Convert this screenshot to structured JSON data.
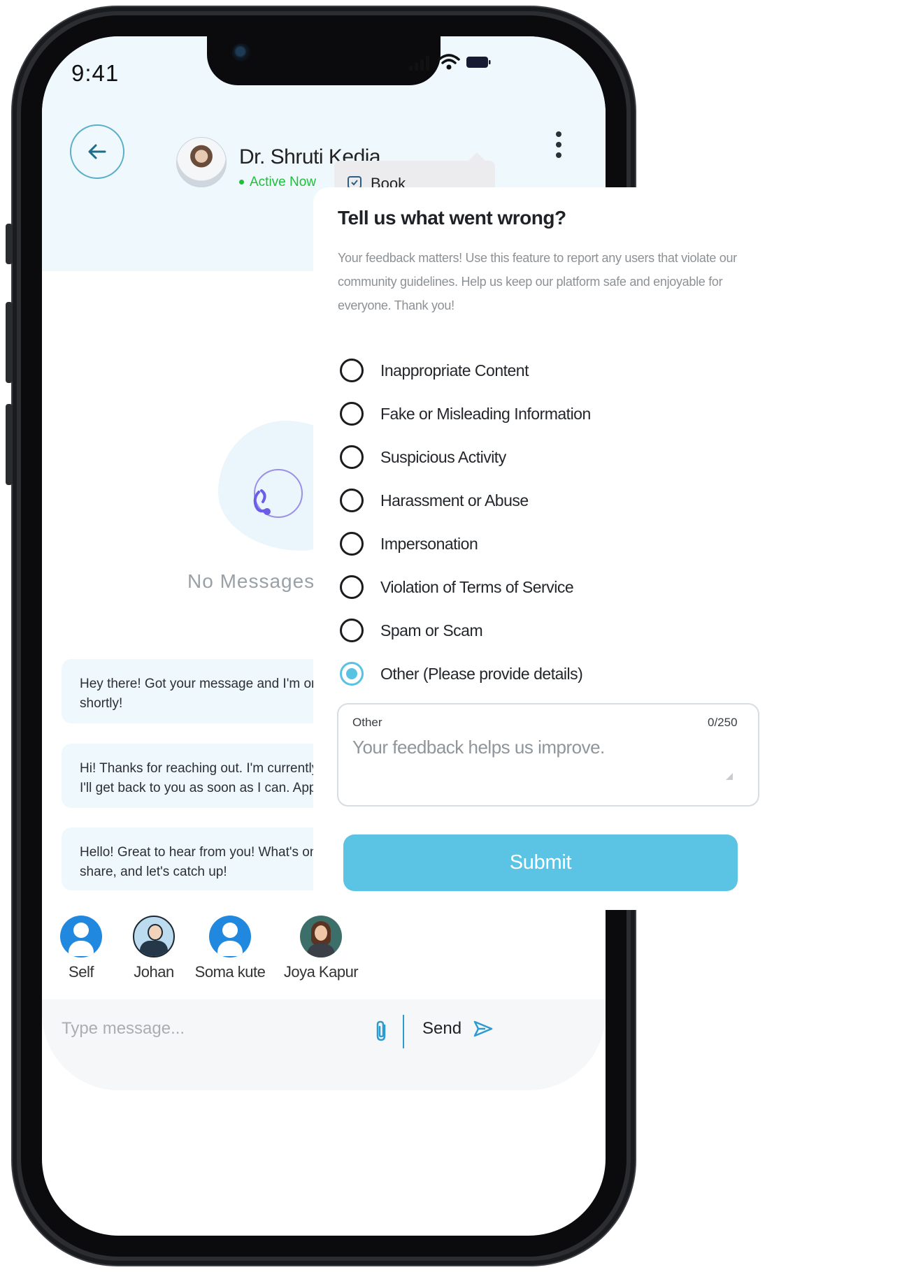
{
  "status_bar": {
    "time": "9:41"
  },
  "chat_header": {
    "doctor_name": "Dr. Shruti Kedia",
    "status": "Active Now",
    "menu_item_label": "Book"
  },
  "empty_state": {
    "text": "No Messages"
  },
  "quick_replies": [
    {
      "line1": "Hey there! Got your message and I'm on i",
      "line2": "shortly!"
    },
    {
      "line1": "Hi! Thanks for reaching out. I'm currently t",
      "line2": "I'll get back to you as soon as I can. Appre"
    },
    {
      "line1": "Hello! Great to hear from you! What's on y",
      "line2": "share, and let's catch up!"
    }
  ],
  "contacts": [
    {
      "name": "Self"
    },
    {
      "name": "Johan"
    },
    {
      "name": "Soma kute"
    },
    {
      "name": "Joya Kapur"
    }
  ],
  "composer": {
    "placeholder": "Type message...",
    "send_label": "Send"
  },
  "feedback": {
    "title": "Tell us what went wrong?",
    "description": "Your feedback matters! Use this feature to report any users that violate our community guidelines. Help us keep our platform safe and enjoyable for everyone. Thank you!",
    "options": [
      {
        "label": "Inappropriate Content",
        "selected": false
      },
      {
        "label": "Fake or Misleading Information",
        "selected": false
      },
      {
        "label": "Suspicious Activity",
        "selected": false
      },
      {
        "label": "Harassment or Abuse",
        "selected": false
      },
      {
        "label": "Impersonation",
        "selected": false
      },
      {
        "label": "Violation of Terms of Service",
        "selected": false
      },
      {
        "label": "Spam or Scam",
        "selected": false
      },
      {
        "label": "Other (Please provide details)",
        "selected": true
      }
    ],
    "textarea": {
      "label": "Other",
      "counter": "0/250",
      "placeholder": "Your feedback helps us improve."
    },
    "submit_label": "Submit"
  },
  "colors": {
    "accent": "#5bc3e3",
    "header_bg": "#eff8fc",
    "active_green": "#1fbf3a",
    "bubble_bg": "#eef8fd"
  }
}
